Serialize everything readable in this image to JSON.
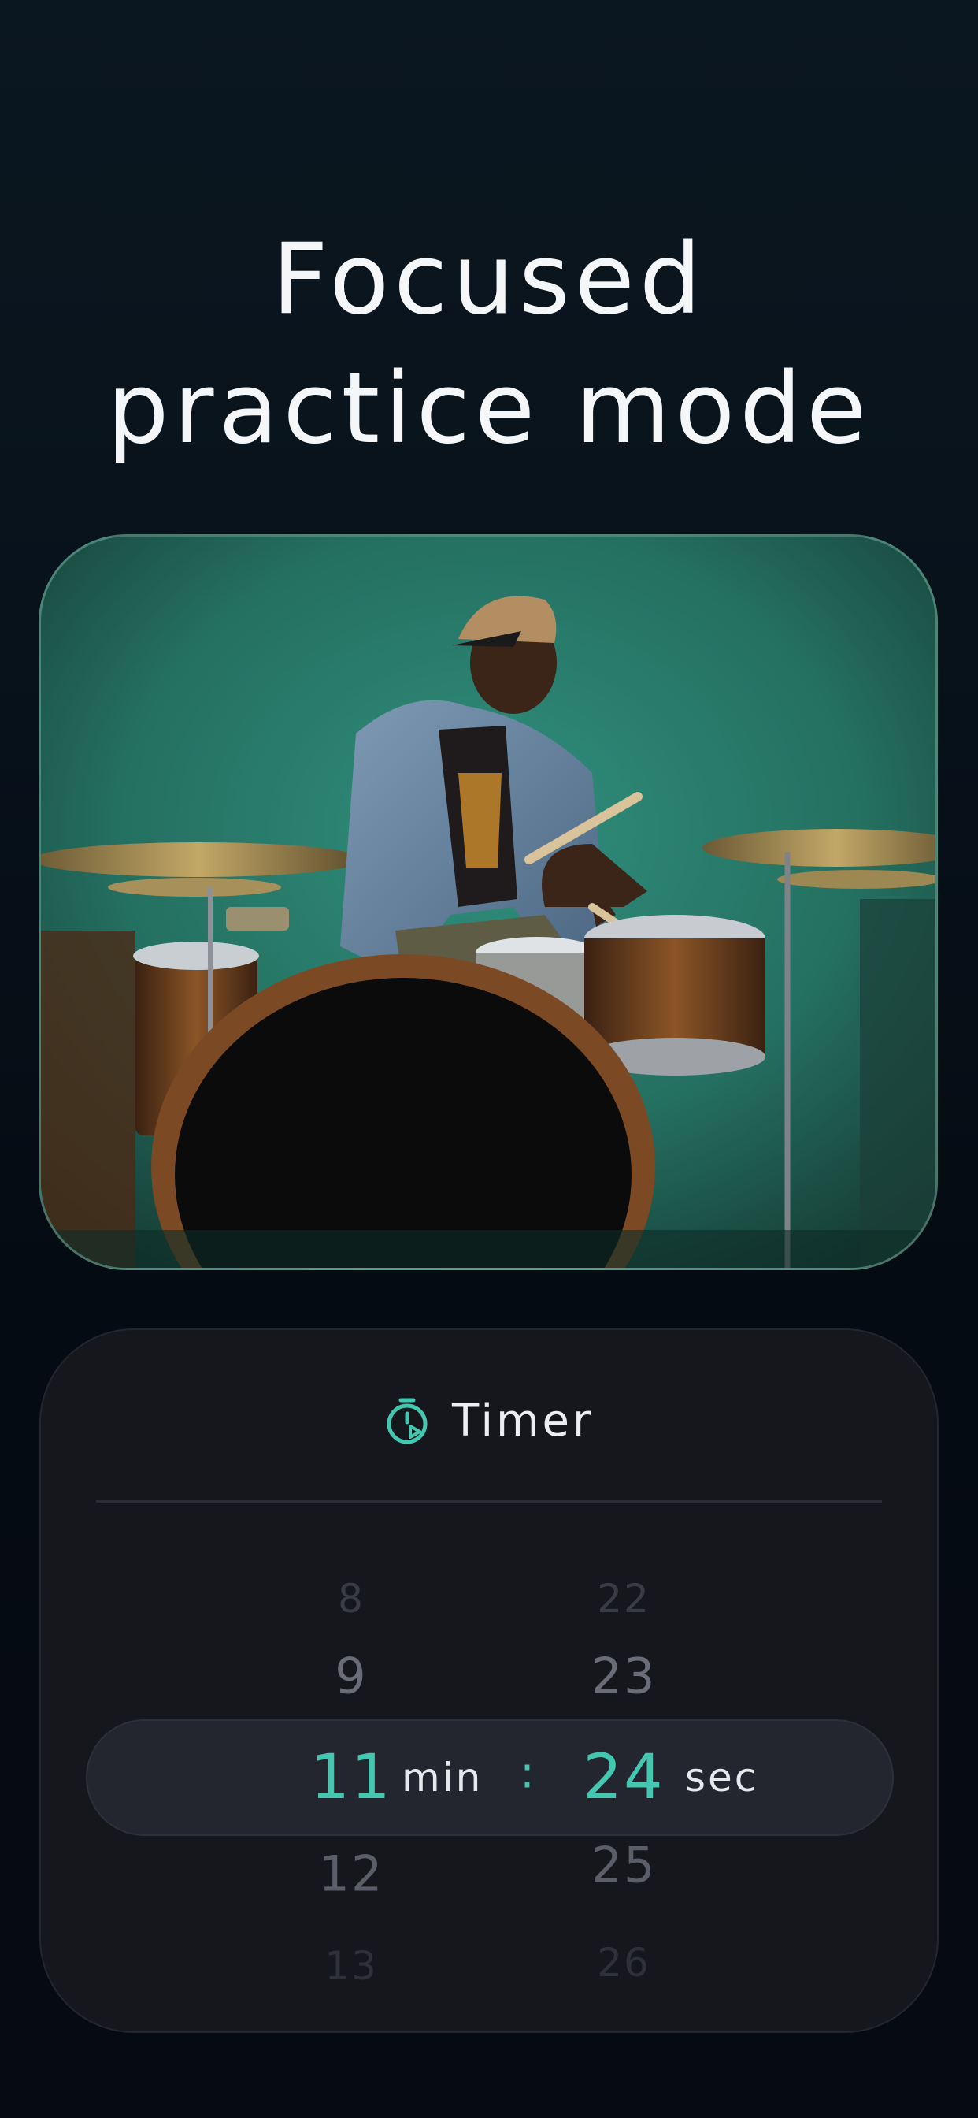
{
  "headline": {
    "line1": "Focused",
    "line2": "practice mode"
  },
  "photo": {
    "subject": "drummer-photo"
  },
  "timer": {
    "title": "Timer",
    "icon": "stopwatch-icon",
    "minutes": {
      "far_up": "8",
      "up": "9",
      "selected": "11",
      "down": "12",
      "far_down": "13",
      "unit": "min"
    },
    "separator": ":",
    "seconds": {
      "far_up": "22",
      "up": "23",
      "selected": "24",
      "down": "25",
      "far_down": "26",
      "unit": "sec"
    }
  },
  "colors": {
    "accent": "#44c7b0",
    "card_bg": "#16171c",
    "page_bg": "#060b12"
  }
}
